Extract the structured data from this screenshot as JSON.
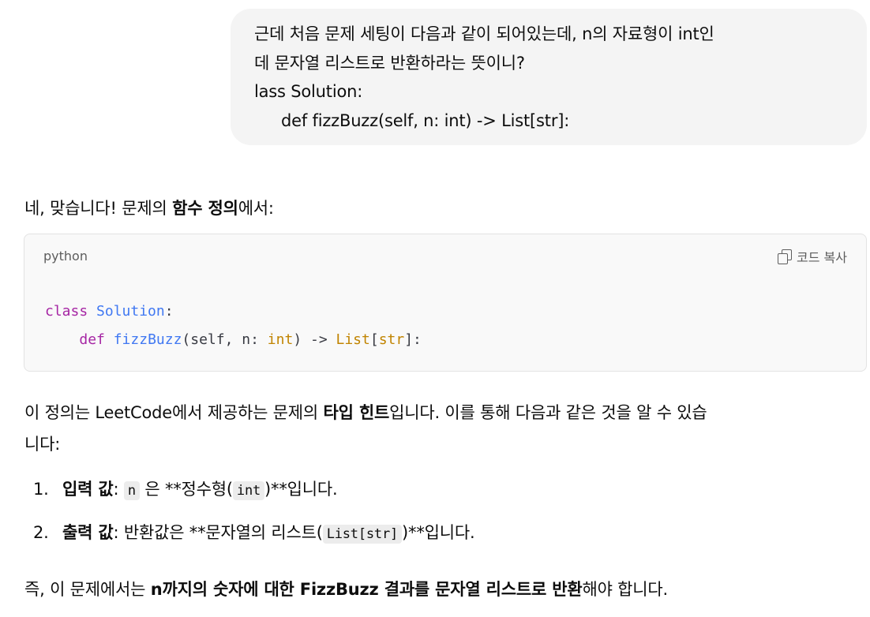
{
  "user_message": {
    "lines": [
      "근데 처음 문제 세팅이 다음과 같이 되어있는데, n의 자료형이 int인",
      "데 문자열 리스트로 반환하라는 뜻이니?",
      "lass Solution:",
      "def fizzBuzz(self, n: int) -> List[str]:"
    ]
  },
  "reply": {
    "intro": {
      "a": "네, 맞습니다! 문제의 ",
      "b": "함수 정의",
      "c": "에서:"
    },
    "code": {
      "language": "python",
      "copy_label": "코드 복사",
      "line1": {
        "kw": "class",
        "name": "Solution",
        "rest": ":"
      },
      "line2": {
        "kw": "def",
        "name": "fizzBuzz",
        "p1": "(self, n: ",
        "t1": "int",
        "p2": ") -> ",
        "t2": "List",
        "p3": "[",
        "t3": "str",
        "p4": "]:"
      }
    },
    "explain": {
      "a": "이 정의는 LeetCode에서 제공하는 문제의 ",
      "b": "타입 힌트",
      "c": "입니다. 이를 통해 다음과 같은 것을 알 수 있습",
      "d": "니다:"
    },
    "items": [
      {
        "num": "1.",
        "label": "입력 값",
        "colon": ": ",
        "code1": "n",
        "mid": " 은 **정수형(",
        "code2": "int",
        "end": ")**입니다."
      },
      {
        "num": "2.",
        "label": "출력 값",
        "colon": ": 반환값은 **문자열의 리스트(",
        "code1": "List[str]",
        "end": ")**입니다."
      }
    ],
    "conclusion": {
      "a": "즉, 이 문제에서는 ",
      "b": "n까지의 숫자에 대한 FizzBuzz 결과를 문자열 리스트로 반환",
      "c": "해야 합니다."
    }
  }
}
